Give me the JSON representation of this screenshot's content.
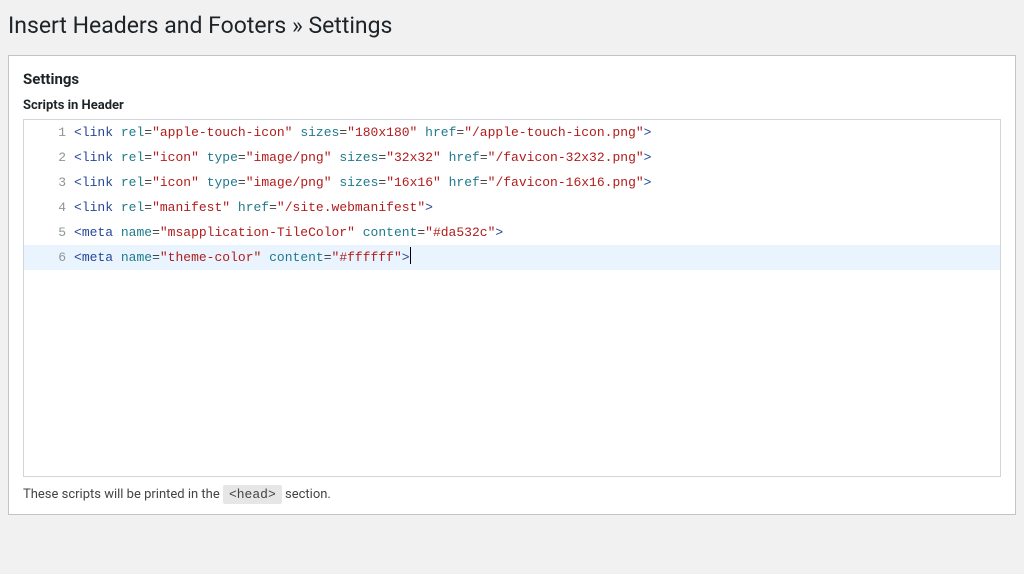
{
  "page": {
    "title": "Insert Headers and Footers » Settings"
  },
  "panel": {
    "heading": "Settings",
    "header_section": {
      "label": "Scripts in Header",
      "active_line": 6,
      "lines": [
        {
          "gutter": "1",
          "tokens": [
            {
              "c": "tok-angle",
              "t": "<"
            },
            {
              "c": "tok-tag",
              "t": "link"
            },
            {
              "c": "",
              "t": " "
            },
            {
              "c": "tok-attr",
              "t": "rel"
            },
            {
              "c": "tok-eq",
              "t": "="
            },
            {
              "c": "tok-str",
              "t": "\"apple-touch-icon\""
            },
            {
              "c": "",
              "t": " "
            },
            {
              "c": "tok-attr",
              "t": "sizes"
            },
            {
              "c": "tok-eq",
              "t": "="
            },
            {
              "c": "tok-str",
              "t": "\"180x180\""
            },
            {
              "c": "",
              "t": " "
            },
            {
              "c": "tok-attr",
              "t": "href"
            },
            {
              "c": "tok-eq",
              "t": "="
            },
            {
              "c": "tok-str",
              "t": "\"/apple-touch-icon.png\""
            },
            {
              "c": "tok-angle",
              "t": ">"
            }
          ]
        },
        {
          "gutter": "2",
          "tokens": [
            {
              "c": "tok-angle",
              "t": "<"
            },
            {
              "c": "tok-tag",
              "t": "link"
            },
            {
              "c": "",
              "t": " "
            },
            {
              "c": "tok-attr",
              "t": "rel"
            },
            {
              "c": "tok-eq",
              "t": "="
            },
            {
              "c": "tok-str",
              "t": "\"icon\""
            },
            {
              "c": "",
              "t": " "
            },
            {
              "c": "tok-attr",
              "t": "type"
            },
            {
              "c": "tok-eq",
              "t": "="
            },
            {
              "c": "tok-str",
              "t": "\"image/png\""
            },
            {
              "c": "",
              "t": " "
            },
            {
              "c": "tok-attr",
              "t": "sizes"
            },
            {
              "c": "tok-eq",
              "t": "="
            },
            {
              "c": "tok-str",
              "t": "\"32x32\""
            },
            {
              "c": "",
              "t": " "
            },
            {
              "c": "tok-attr",
              "t": "href"
            },
            {
              "c": "tok-eq",
              "t": "="
            },
            {
              "c": "tok-str",
              "t": "\"/favicon-32x32.png\""
            },
            {
              "c": "tok-angle",
              "t": ">"
            }
          ]
        },
        {
          "gutter": "3",
          "tokens": [
            {
              "c": "tok-angle",
              "t": "<"
            },
            {
              "c": "tok-tag",
              "t": "link"
            },
            {
              "c": "",
              "t": " "
            },
            {
              "c": "tok-attr",
              "t": "rel"
            },
            {
              "c": "tok-eq",
              "t": "="
            },
            {
              "c": "tok-str",
              "t": "\"icon\""
            },
            {
              "c": "",
              "t": " "
            },
            {
              "c": "tok-attr",
              "t": "type"
            },
            {
              "c": "tok-eq",
              "t": "="
            },
            {
              "c": "tok-str",
              "t": "\"image/png\""
            },
            {
              "c": "",
              "t": " "
            },
            {
              "c": "tok-attr",
              "t": "sizes"
            },
            {
              "c": "tok-eq",
              "t": "="
            },
            {
              "c": "tok-str",
              "t": "\"16x16\""
            },
            {
              "c": "",
              "t": " "
            },
            {
              "c": "tok-attr",
              "t": "href"
            },
            {
              "c": "tok-eq",
              "t": "="
            },
            {
              "c": "tok-str",
              "t": "\"/favicon-16x16.png\""
            },
            {
              "c": "tok-angle",
              "t": ">"
            }
          ]
        },
        {
          "gutter": "4",
          "tokens": [
            {
              "c": "tok-angle",
              "t": "<"
            },
            {
              "c": "tok-tag",
              "t": "link"
            },
            {
              "c": "",
              "t": " "
            },
            {
              "c": "tok-attr",
              "t": "rel"
            },
            {
              "c": "tok-eq",
              "t": "="
            },
            {
              "c": "tok-str",
              "t": "\"manifest\""
            },
            {
              "c": "",
              "t": " "
            },
            {
              "c": "tok-attr",
              "t": "href"
            },
            {
              "c": "tok-eq",
              "t": "="
            },
            {
              "c": "tok-str",
              "t": "\"/site.webmanifest\""
            },
            {
              "c": "tok-angle",
              "t": ">"
            }
          ]
        },
        {
          "gutter": "5",
          "tokens": [
            {
              "c": "tok-angle",
              "t": "<"
            },
            {
              "c": "tok-tag",
              "t": "meta"
            },
            {
              "c": "",
              "t": " "
            },
            {
              "c": "tok-attr",
              "t": "name"
            },
            {
              "c": "tok-eq",
              "t": "="
            },
            {
              "c": "tok-str",
              "t": "\"msapplication-TileColor\""
            },
            {
              "c": "",
              "t": " "
            },
            {
              "c": "tok-attr",
              "t": "content"
            },
            {
              "c": "tok-eq",
              "t": "="
            },
            {
              "c": "tok-str",
              "t": "\"#da532c\""
            },
            {
              "c": "tok-angle",
              "t": ">"
            }
          ]
        },
        {
          "gutter": "6",
          "tokens": [
            {
              "c": "tok-angle",
              "t": "<"
            },
            {
              "c": "tok-tag",
              "t": "meta"
            },
            {
              "c": "",
              "t": " "
            },
            {
              "c": "tok-attr",
              "t": "name"
            },
            {
              "c": "tok-eq",
              "t": "="
            },
            {
              "c": "tok-str",
              "t": "\"theme-color\""
            },
            {
              "c": "",
              "t": " "
            },
            {
              "c": "tok-attr",
              "t": "content"
            },
            {
              "c": "tok-eq",
              "t": "="
            },
            {
              "c": "tok-str",
              "t": "\"#ffffff\""
            },
            {
              "c": "tok-angle",
              "t": ">"
            }
          ]
        }
      ],
      "help": {
        "before": "These scripts will be printed in the ",
        "code": "<head>",
        "after": " section."
      }
    }
  }
}
